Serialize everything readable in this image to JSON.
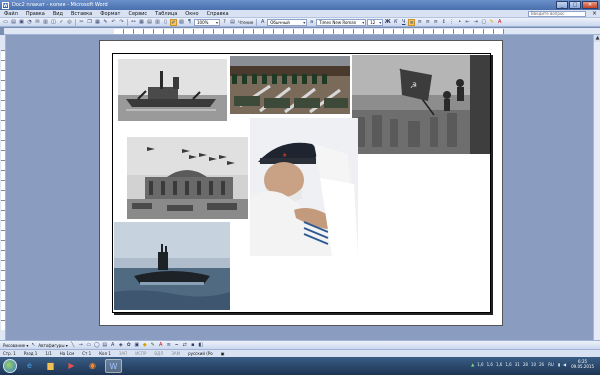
{
  "window": {
    "title": "Doc2 плакат - копия - Microsoft Word",
    "app_icon": "W",
    "buttons": {
      "minimize": "_",
      "maximize": "□",
      "close": "✕"
    }
  },
  "menu": {
    "items": [
      "Файл",
      "Правка",
      "Вид",
      "Вставка",
      "Формат",
      "Сервис",
      "Таблица",
      "Окно",
      "Справка"
    ],
    "help_placeholder": "Введите вопрос"
  },
  "toolbar": {
    "zoom": "100%",
    "read_label": "Чтение",
    "style": "Обычный",
    "font": "Times New Roman",
    "size": "12"
  },
  "drawbar": {
    "draw_label": "Рисование ▾",
    "autoshapes_label": "Автофигуры ▾"
  },
  "status": {
    "page": "Стр. 1",
    "section": "Разд 1",
    "pages": "1/1",
    "at": "На 1см",
    "line": "Ст 1",
    "col": "Кол 1",
    "modes": [
      "ЗАП",
      "ИСПР",
      "ВДЛ",
      "ЗАМ"
    ],
    "lang": "русский (Ро"
  },
  "taskbar": {
    "tray_numbers": [
      "1,6",
      "1,6",
      "1,6",
      "1,6",
      "31",
      "28",
      "10",
      "26"
    ],
    "lang": "RU",
    "time": "6:25",
    "date": "09.05.2015"
  },
  "colors": {
    "title_bar": "#4a6fae",
    "menu_bg": "#d8e2f3",
    "doc_bg": "#8a9cc0",
    "taskbar": "#1d3553"
  }
}
